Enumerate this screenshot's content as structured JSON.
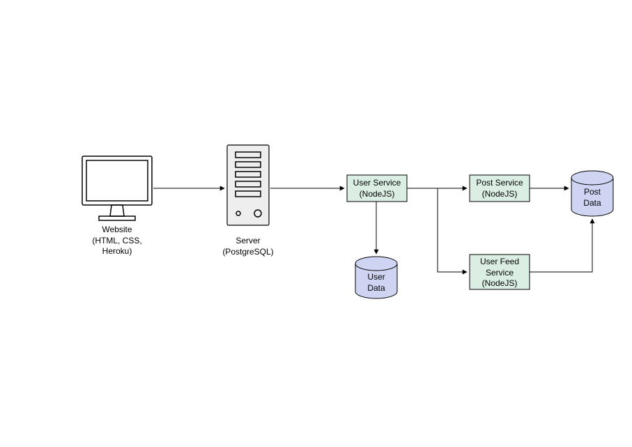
{
  "nodes": {
    "website": {
      "label": "Website\n(HTML, CSS,\nHeroku)"
    },
    "server": {
      "label": "Server\n(PostgreSQL)"
    },
    "user_service": {
      "label": "User Service\n(NodeJS)"
    },
    "post_service": {
      "label": "Post Service\n(NodeJS)"
    },
    "user_feed_service": {
      "label": "User Feed\nService\n(NodeJS)"
    },
    "user_data": {
      "label": "User\nData"
    },
    "post_data": {
      "label": "Post\nData"
    }
  },
  "colors": {
    "service_fill": "#dbeee4",
    "cylinder_fill": "#cfd4f2"
  }
}
